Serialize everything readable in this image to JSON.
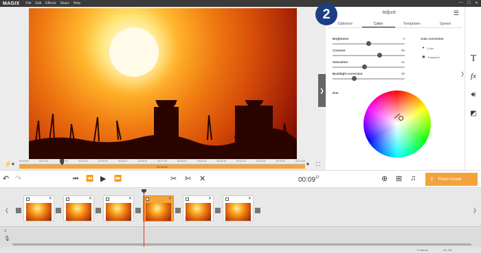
{
  "app": {
    "logo": "MAGIX"
  },
  "menu": [
    "File",
    "Edit",
    "Effects",
    "Share",
    "Help"
  ],
  "badge": "2",
  "ruler_ticks": [
    "00:00:00",
    "00:01:00",
    "00:02:00",
    "00:03:00",
    "00:04:00",
    "00:05:00",
    "00:06:00",
    "00:07:00",
    "00:08:00",
    "00:09:00",
    "00:10:00",
    "00:11:00",
    "00:12:00",
    "00:13:00",
    "00:14:00"
  ],
  "scrub": {
    "current_label": "00:15:04",
    "position": 0.15
  },
  "panel": {
    "title": "Adjust",
    "tabs": [
      {
        "label": "Optimize",
        "active": false
      },
      {
        "label": "Color",
        "active": true
      },
      {
        "label": "Templates",
        "active": false
      },
      {
        "label": "Speed",
        "active": false
      }
    ],
    "sliders": [
      {
        "label": "Brightness",
        "value": "0",
        "level": 0.5
      },
      {
        "label": "Contrast",
        "value": "65",
        "level": 0.65
      },
      {
        "label": "Saturation",
        "value": "-11",
        "level": 0.44
      },
      {
        "label": "Backlight correction",
        "value": "30",
        "level": 0.3
      }
    ],
    "auto_correction": {
      "title": "Auto correction",
      "items": [
        {
          "label": "Color",
          "icon": "palette-icon"
        },
        {
          "label": "Exposure",
          "icon": "sun-icon"
        }
      ]
    },
    "hue_label": "Hue"
  },
  "right_toolbar": [
    "text-icon",
    "fx-icon",
    "volume-icon",
    "gradient-icon"
  ],
  "transport": {
    "time_main": "00:09",
    "time_frames": "12",
    "finish_label": "Finish movie"
  },
  "timeline": {
    "clip_count": 6,
    "selected_clip": 4
  },
  "status": {
    "a": "6 objects",
    "b": "0m 23s"
  },
  "colors": {
    "accent": "#f4a23a",
    "badge": "#1c3f83",
    "playline": "#d04020"
  }
}
